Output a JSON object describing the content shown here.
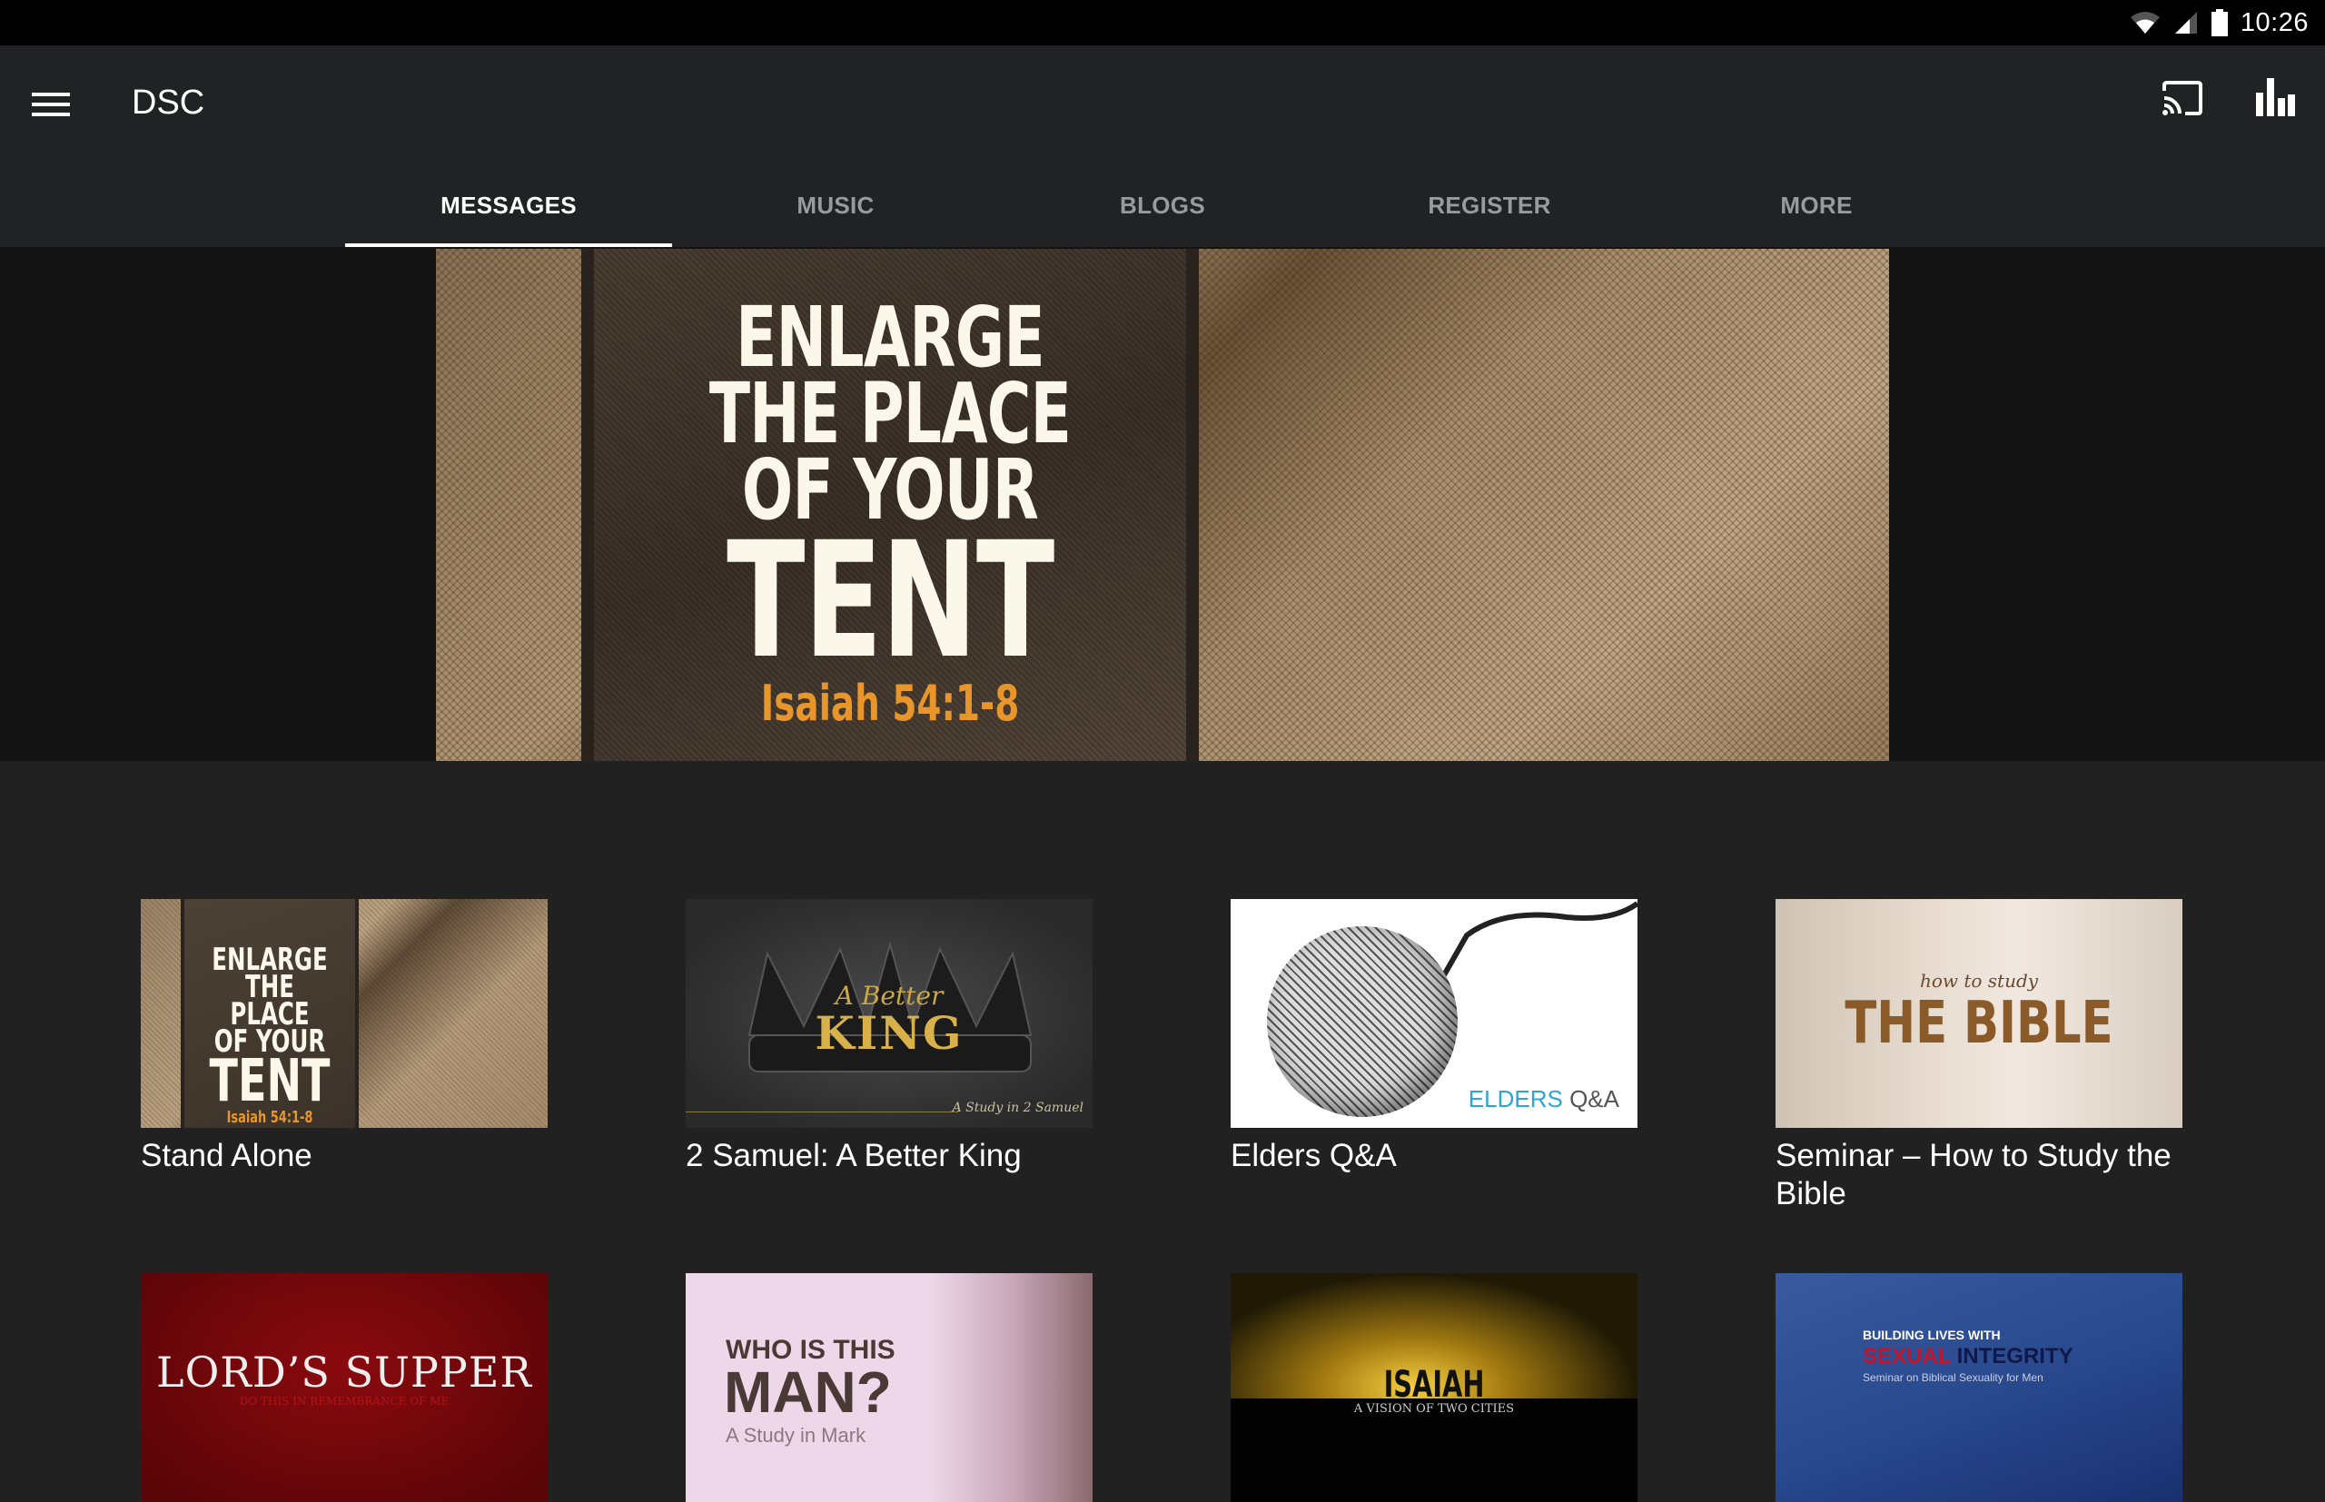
{
  "status_bar": {
    "time": "10:26",
    "icons": [
      "wifi-icon",
      "cell-signal-icon",
      "battery-icon"
    ]
  },
  "app_bar": {
    "title": "DSC",
    "menu_icon": "hamburger-menu-icon",
    "actions": [
      "cast-icon",
      "bar-chart-icon"
    ]
  },
  "tabs": [
    {
      "label": "MESSAGES",
      "active": true
    },
    {
      "label": "MUSIC",
      "active": false
    },
    {
      "label": "BLOGS",
      "active": false
    },
    {
      "label": "REGISTER",
      "active": false
    },
    {
      "label": "MORE",
      "active": false
    }
  ],
  "hero": {
    "lines": [
      "ENLARGE",
      "THE PLACE",
      "OF YOUR"
    ],
    "big_word": "TENT",
    "reference": "Isaiah 54:1-8",
    "reference_color": "#e8962a"
  },
  "series": [
    {
      "title": "Stand Alone",
      "art": {
        "lines": [
          "ENLARGE",
          "THE PLACE",
          "OF YOUR"
        ],
        "big": "TENT",
        "ref": "Isaiah 54:1-8"
      }
    },
    {
      "title": "2 Samuel: A Better King",
      "art": {
        "top": "A Better",
        "main": "KING",
        "sub": "A Study in 2 Samuel"
      }
    },
    {
      "title": "Elders Q&A",
      "art": {
        "word1": "ELDERS",
        "word2": "Q&A",
        "color1": "#2aa6d6",
        "color2": "#555555"
      }
    },
    {
      "title": "Seminar – How to Study the Bible",
      "art": {
        "top": "how to study",
        "main": "THE BIBLE"
      }
    },
    {
      "title": "",
      "art": {
        "main": "LORD’S SUPPER",
        "sub": "DO THIS IN REMEMBRANCE OF ME"
      }
    },
    {
      "title": "",
      "art": {
        "top": "WHO IS THIS",
        "main": "MAN?",
        "sub": "A Study in Mark"
      }
    },
    {
      "title": "",
      "art": {
        "main": "ISAIAH",
        "sub": "A VISION OF TWO CITIES"
      }
    },
    {
      "title": "",
      "art": {
        "top": "BUILDING LIVES WITH",
        "main1": "SEXUAL",
        "main2": "INTEGRITY",
        "sub": "Seminar on Biblical Sexuality for Men",
        "color1": "#c0142a",
        "color2": "#101848"
      }
    }
  ]
}
